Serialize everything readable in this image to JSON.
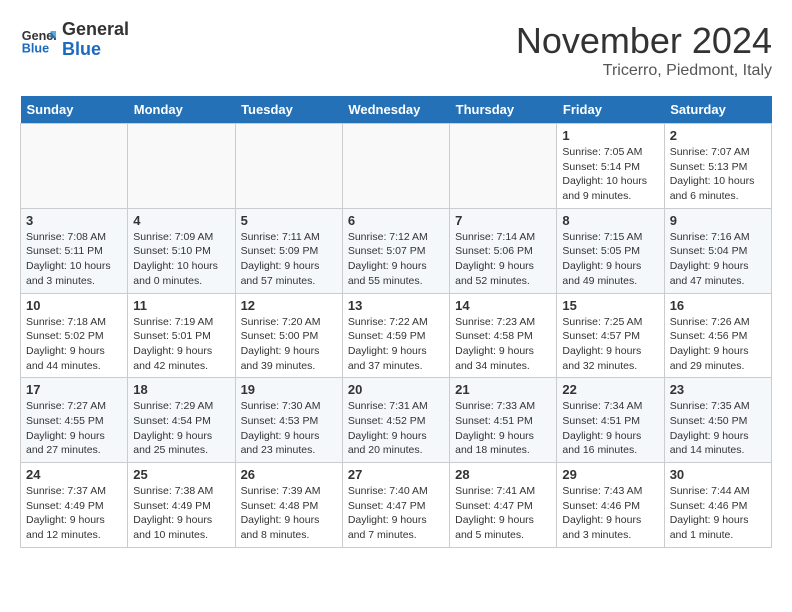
{
  "header": {
    "logo_line1": "General",
    "logo_line2": "Blue",
    "month": "November 2024",
    "location": "Tricerro, Piedmont, Italy"
  },
  "days_of_week": [
    "Sunday",
    "Monday",
    "Tuesday",
    "Wednesday",
    "Thursday",
    "Friday",
    "Saturday"
  ],
  "weeks": [
    [
      {
        "num": "",
        "info": ""
      },
      {
        "num": "",
        "info": ""
      },
      {
        "num": "",
        "info": ""
      },
      {
        "num": "",
        "info": ""
      },
      {
        "num": "",
        "info": ""
      },
      {
        "num": "1",
        "info": "Sunrise: 7:05 AM\nSunset: 5:14 PM\nDaylight: 10 hours\nand 9 minutes."
      },
      {
        "num": "2",
        "info": "Sunrise: 7:07 AM\nSunset: 5:13 PM\nDaylight: 10 hours\nand 6 minutes."
      }
    ],
    [
      {
        "num": "3",
        "info": "Sunrise: 7:08 AM\nSunset: 5:11 PM\nDaylight: 10 hours\nand 3 minutes."
      },
      {
        "num": "4",
        "info": "Sunrise: 7:09 AM\nSunset: 5:10 PM\nDaylight: 10 hours\nand 0 minutes."
      },
      {
        "num": "5",
        "info": "Sunrise: 7:11 AM\nSunset: 5:09 PM\nDaylight: 9 hours\nand 57 minutes."
      },
      {
        "num": "6",
        "info": "Sunrise: 7:12 AM\nSunset: 5:07 PM\nDaylight: 9 hours\nand 55 minutes."
      },
      {
        "num": "7",
        "info": "Sunrise: 7:14 AM\nSunset: 5:06 PM\nDaylight: 9 hours\nand 52 minutes."
      },
      {
        "num": "8",
        "info": "Sunrise: 7:15 AM\nSunset: 5:05 PM\nDaylight: 9 hours\nand 49 minutes."
      },
      {
        "num": "9",
        "info": "Sunrise: 7:16 AM\nSunset: 5:04 PM\nDaylight: 9 hours\nand 47 minutes."
      }
    ],
    [
      {
        "num": "10",
        "info": "Sunrise: 7:18 AM\nSunset: 5:02 PM\nDaylight: 9 hours\nand 44 minutes."
      },
      {
        "num": "11",
        "info": "Sunrise: 7:19 AM\nSunset: 5:01 PM\nDaylight: 9 hours\nand 42 minutes."
      },
      {
        "num": "12",
        "info": "Sunrise: 7:20 AM\nSunset: 5:00 PM\nDaylight: 9 hours\nand 39 minutes."
      },
      {
        "num": "13",
        "info": "Sunrise: 7:22 AM\nSunset: 4:59 PM\nDaylight: 9 hours\nand 37 minutes."
      },
      {
        "num": "14",
        "info": "Sunrise: 7:23 AM\nSunset: 4:58 PM\nDaylight: 9 hours\nand 34 minutes."
      },
      {
        "num": "15",
        "info": "Sunrise: 7:25 AM\nSunset: 4:57 PM\nDaylight: 9 hours\nand 32 minutes."
      },
      {
        "num": "16",
        "info": "Sunrise: 7:26 AM\nSunset: 4:56 PM\nDaylight: 9 hours\nand 29 minutes."
      }
    ],
    [
      {
        "num": "17",
        "info": "Sunrise: 7:27 AM\nSunset: 4:55 PM\nDaylight: 9 hours\nand 27 minutes."
      },
      {
        "num": "18",
        "info": "Sunrise: 7:29 AM\nSunset: 4:54 PM\nDaylight: 9 hours\nand 25 minutes."
      },
      {
        "num": "19",
        "info": "Sunrise: 7:30 AM\nSunset: 4:53 PM\nDaylight: 9 hours\nand 23 minutes."
      },
      {
        "num": "20",
        "info": "Sunrise: 7:31 AM\nSunset: 4:52 PM\nDaylight: 9 hours\nand 20 minutes."
      },
      {
        "num": "21",
        "info": "Sunrise: 7:33 AM\nSunset: 4:51 PM\nDaylight: 9 hours\nand 18 minutes."
      },
      {
        "num": "22",
        "info": "Sunrise: 7:34 AM\nSunset: 4:51 PM\nDaylight: 9 hours\nand 16 minutes."
      },
      {
        "num": "23",
        "info": "Sunrise: 7:35 AM\nSunset: 4:50 PM\nDaylight: 9 hours\nand 14 minutes."
      }
    ],
    [
      {
        "num": "24",
        "info": "Sunrise: 7:37 AM\nSunset: 4:49 PM\nDaylight: 9 hours\nand 12 minutes."
      },
      {
        "num": "25",
        "info": "Sunrise: 7:38 AM\nSunset: 4:49 PM\nDaylight: 9 hours\nand 10 minutes."
      },
      {
        "num": "26",
        "info": "Sunrise: 7:39 AM\nSunset: 4:48 PM\nDaylight: 9 hours\nand 8 minutes."
      },
      {
        "num": "27",
        "info": "Sunrise: 7:40 AM\nSunset: 4:47 PM\nDaylight: 9 hours\nand 7 minutes."
      },
      {
        "num": "28",
        "info": "Sunrise: 7:41 AM\nSunset: 4:47 PM\nDaylight: 9 hours\nand 5 minutes."
      },
      {
        "num": "29",
        "info": "Sunrise: 7:43 AM\nSunset: 4:46 PM\nDaylight: 9 hours\nand 3 minutes."
      },
      {
        "num": "30",
        "info": "Sunrise: 7:44 AM\nSunset: 4:46 PM\nDaylight: 9 hours\nand 1 minute."
      }
    ]
  ]
}
